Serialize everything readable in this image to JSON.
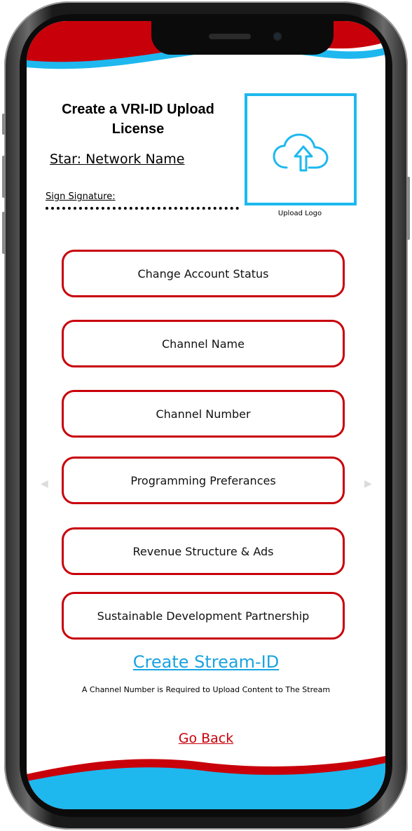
{
  "header": {
    "title": "Create a VRI-ID Upload License",
    "star_name": "Star: Network Name",
    "sign_label": "Sign Signature:"
  },
  "upload": {
    "label": "Upload Logo",
    "icon": "cloud-upload-icon"
  },
  "options": [
    {
      "label": "Change Account Status"
    },
    {
      "label": "Channel Name"
    },
    {
      "label": "Channel Number"
    },
    {
      "label": "Programming Preferances"
    },
    {
      "label": "Revenue Structure & Ads"
    },
    {
      "label": "Sustainable Development Partnership"
    }
  ],
  "nav": {
    "prev_icon": "chevron-left-icon",
    "next_icon": "chevron-right-icon"
  },
  "footer": {
    "create_link": "Create Stream-ID",
    "note": "A Channel Number is Required to Upload Content to The Stream",
    "back_link": "Go Back"
  },
  "colors": {
    "accent_red": "#c8000a",
    "accent_blue": "#1eb8ef",
    "link_blue": "#1aa3e0"
  }
}
